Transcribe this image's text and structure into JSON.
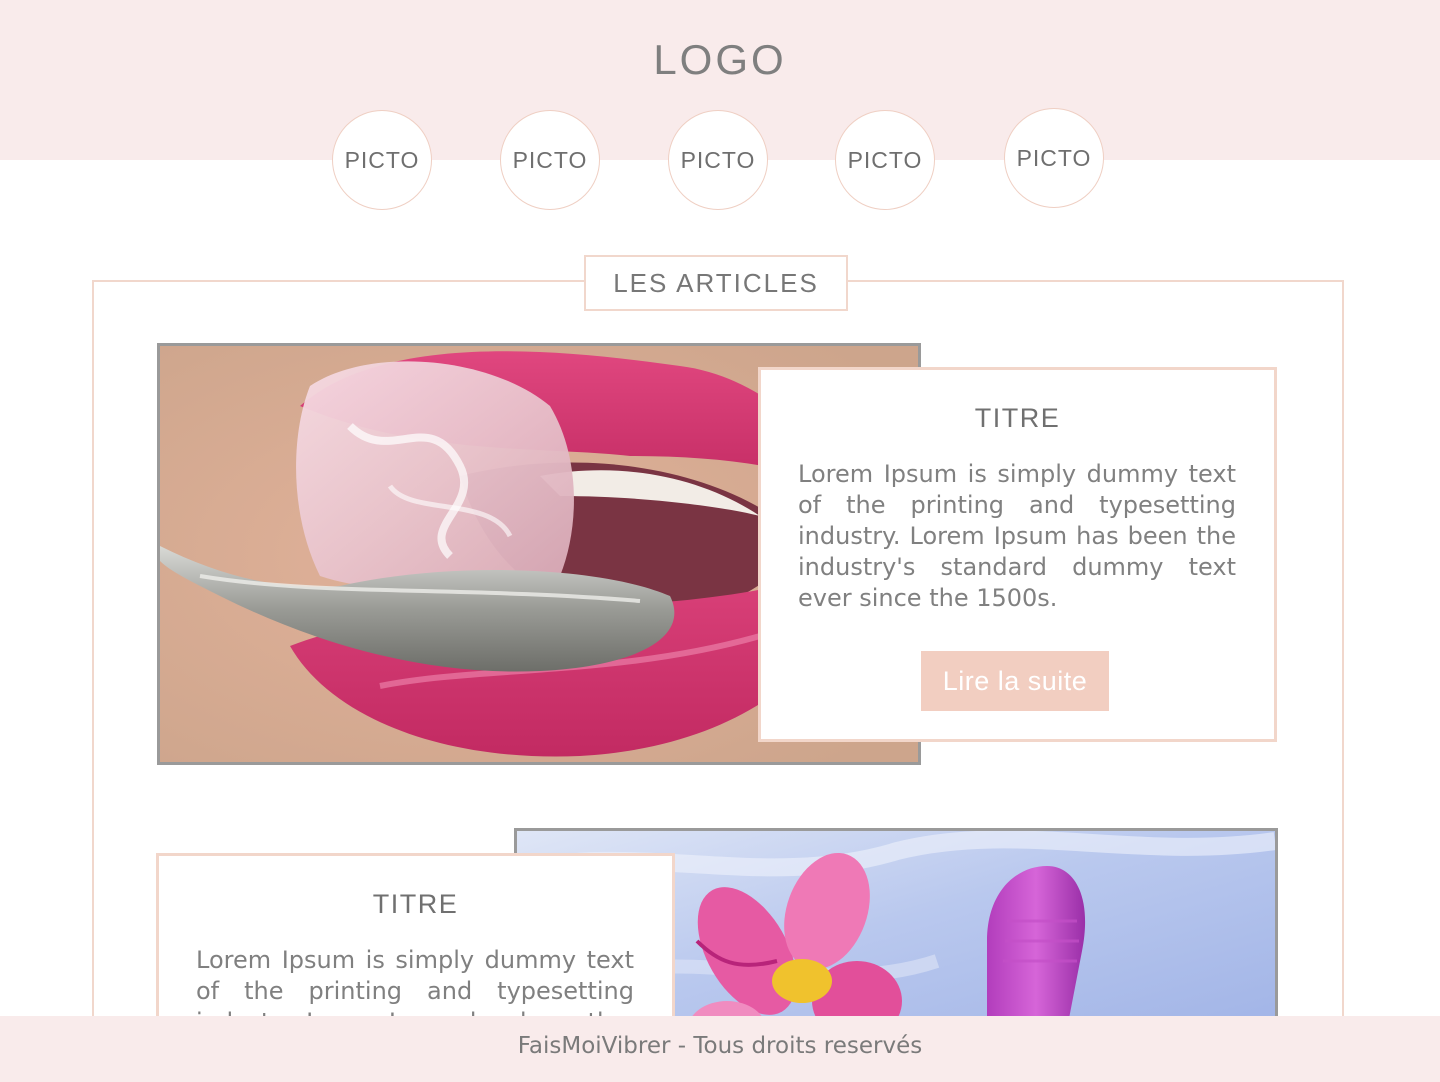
{
  "header": {
    "logo": "LOGO",
    "pictos": [
      "PICTO",
      "PICTO",
      "PICTO",
      "PICTO",
      "PICTO"
    ]
  },
  "section": {
    "title": "LES ARTICLES"
  },
  "articles": [
    {
      "title": "TITRE",
      "text": "Lorem Ipsum is simply dummy text of the printing and typesetting industry. Lorem Ipsum has been the industry's standard dummy text ever since the 1500s.",
      "button": "Lire la suite"
    },
    {
      "title": "TITRE",
      "text": "Lorem Ipsum is simply dummy text of the printing and typesetting industry. Lorem Ipsum has been the"
    }
  ],
  "footer": {
    "text": "FaisMoiVibrer - Tous droits reservés"
  },
  "colors": {
    "header_bg": "#f9ebeb",
    "accent": "#f2cec1",
    "border": "#f1d7cc"
  }
}
